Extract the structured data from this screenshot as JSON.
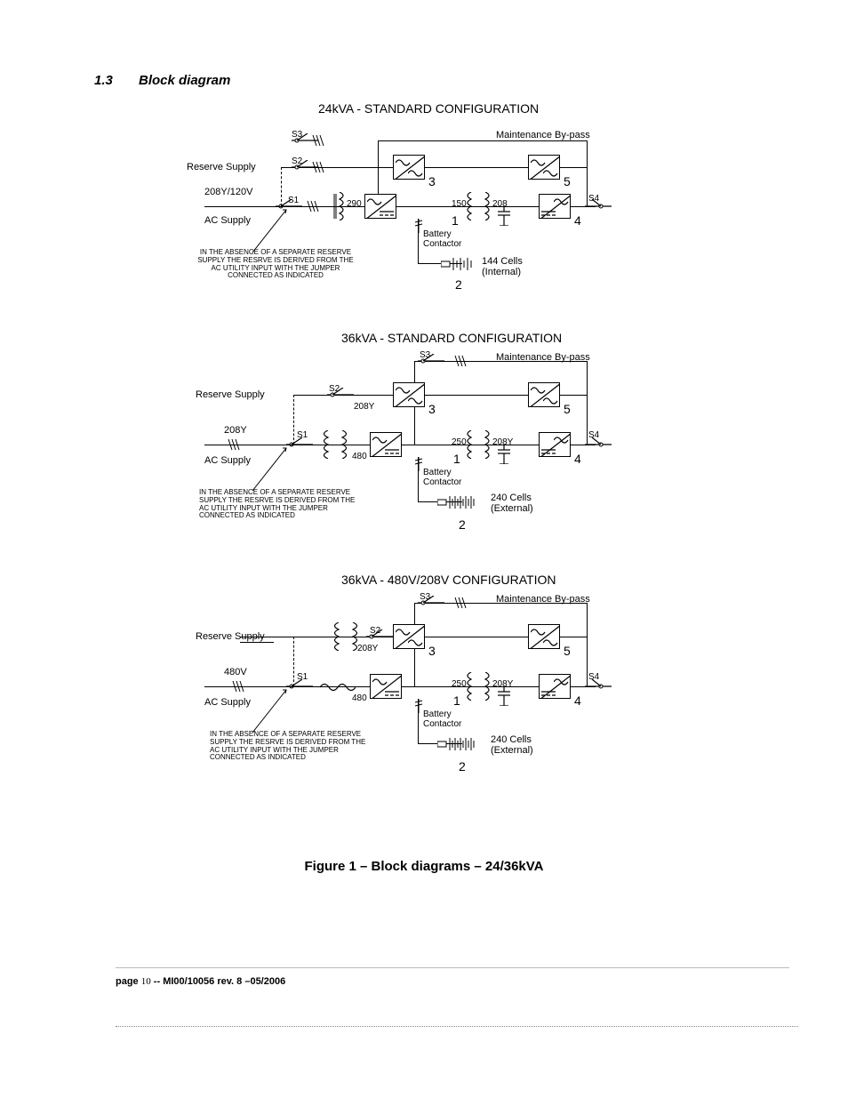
{
  "section": {
    "number": "1.3",
    "title": "Block diagram"
  },
  "diagrams": {
    "d1": {
      "title": "24kVA - STANDARD CONFIGURATION",
      "reserve": "Reserve Supply",
      "voltage": "208Y/120V",
      "ac": "AC Supply",
      "s1": "S1",
      "s2": "S2",
      "s3": "S3",
      "s4": "S4",
      "maint": "Maintenance By-pass",
      "v_in": "290",
      "v_bus": "150",
      "v_out": "208",
      "batt_cont": "Battery\nContactor",
      "cells": "144 Cells",
      "cells_loc": "(Internal)",
      "note": "IN THE ABSENCE OF A SEPARATE RESERVE\nSUPPLY THE RESRVE IS DERIVED FROM THE\nAC UTILITY INPUT WITH THE JUMPER\nCONNECTED AS INDICATED",
      "n1": "1",
      "n2": "2",
      "n3": "3",
      "n4": "4",
      "n5": "5"
    },
    "d2": {
      "title": "36kVA - STANDARD CONFIGURATION",
      "reserve": "Reserve Supply",
      "voltage": "208Y",
      "ac": "AC Supply",
      "s1": "S1",
      "s2": "S2",
      "s3": "S3",
      "s4": "S4",
      "maint": "Maintenance By-pass",
      "v_aux": "208Y",
      "v_in": "480",
      "v_bus": "250",
      "v_out": "208Y",
      "batt_cont": "Battery\nContactor",
      "cells": "240 Cells",
      "cells_loc": "(External)",
      "note": "IN THE ABSENCE OF A SEPARATE RESERVE\nSUPPLY THE RESRVE IS DERIVED FROM THE\nAC UTILITY INPUT WITH THE JUMPER\nCONNECTED AS INDICATED",
      "n1": "1",
      "n2": "2",
      "n3": "3",
      "n4": "4",
      "n5": "5"
    },
    "d3": {
      "title": "36kVA - 480V/208V CONFIGURATION",
      "reserve": "Reserve Supply",
      "voltage": "480V",
      "ac": "AC Supply",
      "s1": "S1",
      "s2": "S2",
      "s3": "S3",
      "s4": "S4",
      "maint": "Maintenance By-pass",
      "v_aux": "208Y",
      "v_in": "480",
      "v_bus": "250",
      "v_out": "208Y",
      "batt_cont": "Battery\nContactor",
      "cells": "240 Cells",
      "cells_loc": "(External)",
      "note": "IN THE ABSENCE OF A SEPARATE RESERVE\nSUPPLY THE RESRVE IS DERIVED FROM THE\nAC UTILITY INPUT WITH THE JUMPER\nCONNECTED AS INDICATED",
      "n1": "1",
      "n2": "2",
      "n3": "3",
      "n4": "4",
      "n5": "5"
    }
  },
  "figure_caption": "Figure 1 – Block diagrams – 24/36kVA",
  "footer": {
    "page_word": "page",
    "page_num": "10",
    "rest": " -- MI00/10056 rev. 8 –05/2006"
  }
}
